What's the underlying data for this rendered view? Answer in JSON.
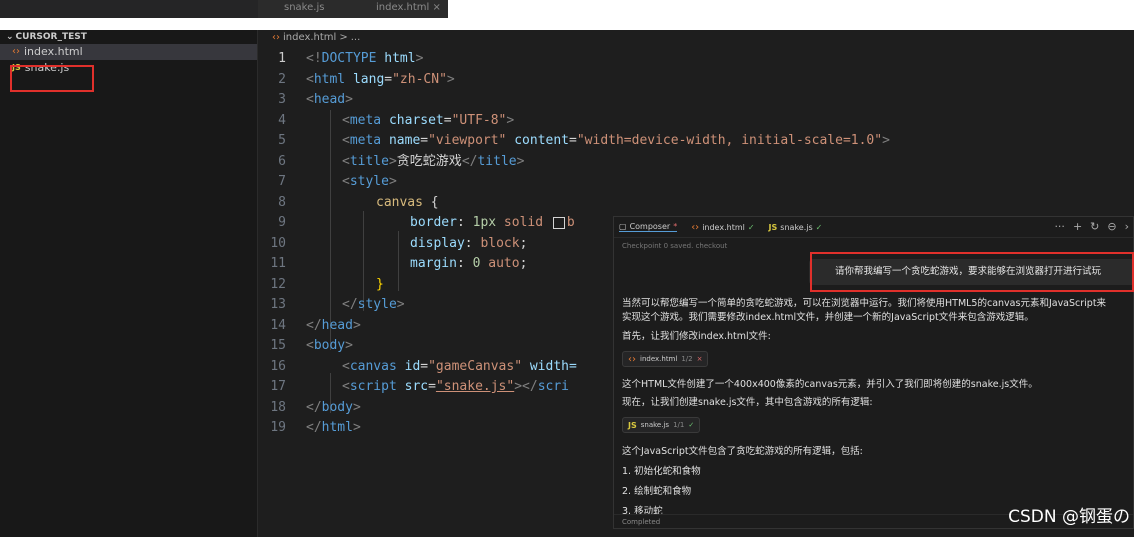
{
  "tabs": {
    "tab1": "snake.js",
    "tab2": "index.html ×"
  },
  "explorer": {
    "title": "CURSOR_TEST",
    "files": [
      {
        "name": "index.html",
        "type": "html"
      },
      {
        "name": "snake.js",
        "type": "js",
        "icon_label": "JS"
      }
    ]
  },
  "breadcrumb": {
    "file": "index.html",
    "sep": ">",
    "more": "..."
  },
  "code_lines": [
    "1",
    "2",
    "3",
    "4",
    "5",
    "6",
    "7",
    "8",
    "9",
    "10",
    "11",
    "12",
    "13",
    "14",
    "15",
    "16",
    "17",
    "18",
    "19"
  ],
  "code": {
    "l1": [
      "<!",
      "DOCTYPE",
      " html",
      ">"
    ],
    "l2": [
      "<",
      "html",
      " lang",
      "=",
      "\"zh-CN\"",
      ">"
    ],
    "l3": [
      "<",
      "head",
      ">"
    ],
    "l4": [
      "<",
      "meta",
      " charset",
      "=",
      "\"UTF-8\"",
      ">"
    ],
    "l5": [
      "<",
      "meta",
      " name",
      "=",
      "\"viewport\"",
      " content",
      "=",
      "\"width=device-width, initial-scale=1.0\"",
      ">"
    ],
    "l6": [
      "<",
      "title",
      ">",
      "贪吃蛇游戏",
      "</",
      "title",
      ">"
    ],
    "l7": [
      "<",
      "style",
      ">"
    ],
    "l8": [
      "canvas",
      " {"
    ],
    "l9": [
      "border",
      ": ",
      "1px",
      " solid ",
      "b"
    ],
    "l10": [
      "display",
      ": ",
      "block",
      ";"
    ],
    "l11": [
      "margin",
      ": ",
      "0",
      " auto",
      ";"
    ],
    "l12": [
      "}"
    ],
    "l13": [
      "</",
      "style",
      ">"
    ],
    "l14": [
      "</",
      "head",
      ">"
    ],
    "l15": [
      "<",
      "body",
      ">"
    ],
    "l16": [
      "<",
      "canvas",
      " id",
      "=",
      "\"gameCanvas\"",
      " width="
    ],
    "l17": [
      "<",
      "script",
      " src",
      "=",
      "\"snake.js\"",
      "></",
      "scri"
    ],
    "l18": [
      "</",
      "body",
      ">"
    ],
    "l19": [
      "</",
      "html",
      ">"
    ]
  },
  "composer": {
    "tab_composer": "Composer",
    "tab_composer_mark": "*",
    "tab_index": "index.html",
    "tab_snake": "snake.js",
    "check_mark": "✓",
    "actions": [
      "···",
      "+",
      "↻",
      "⊖",
      "›"
    ],
    "checkpoint": "Checkpoint 0 saved. checkout",
    "user_prompt": "请你帮我编写一个贪吃蛇游戏，要求能够在浏览器打开进行试玩",
    "p1": "当然可以帮您编写一个简单的贪吃蛇游戏，可以在浏览器中运行。我们将使用HTML5的canvas元素和JavaScript来",
    "p2": "实现这个游戏。我们需要修改index.html文件，并创建一个新的JavaScript文件来包含游戏逻辑。",
    "p3": "首先，让我们修改index.html文件:",
    "chip1_name": "index.html",
    "chip1_meta": "1/2",
    "chip1_mark": "×",
    "p4": "这个HTML文件创建了一个400x400像素的canvas元素，并引入了我们即将创建的snake.js文件。",
    "p5": "现在，让我们创建snake.js文件，其中包含游戏的所有逻辑:",
    "chip2_name": "snake.js",
    "chip2_meta": "1/1",
    "chip2_mark": "✓",
    "p6": "这个JavaScript文件包含了贪吃蛇游戏的所有逻辑，包括:",
    "list1": "1. 初始化蛇和食物",
    "list2": "2. 绘制蛇和食物",
    "list3": "3. 移动蛇",
    "footer": "Completed"
  },
  "watermark": "CSDN @钢蛋の"
}
